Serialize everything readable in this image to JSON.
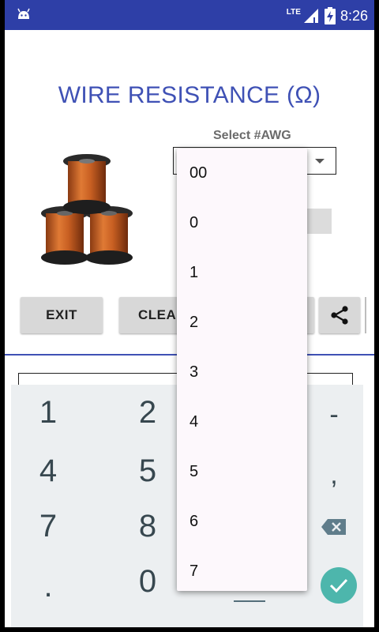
{
  "status_bar": {
    "network": "LTE",
    "time": "8:26"
  },
  "app": {
    "title": "WIRE RESISTANCE (Ω)"
  },
  "awg": {
    "label": "Select #AWG",
    "options": [
      "00",
      "0",
      "1",
      "2",
      "3",
      "4",
      "5",
      "6",
      "7"
    ]
  },
  "buttons": {
    "exit": "EXIT",
    "clear": "CLEAR"
  },
  "keyboard": {
    "keys": [
      "1",
      "2",
      "-",
      "4",
      "5",
      ",",
      "7",
      "8",
      ".",
      "0"
    ]
  },
  "colors": {
    "status_bar": "#2e3fa7",
    "accent": "#3f51b5",
    "done": "#4db6ac"
  }
}
